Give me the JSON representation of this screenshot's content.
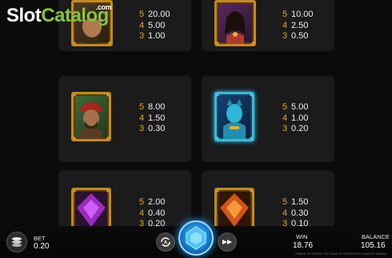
{
  "logo": {
    "part1": "Slot",
    "part2": "Catalog",
    "suffix": ".com"
  },
  "symbols": [
    {
      "name": "prince-symbol",
      "pays": [
        {
          "count": "5",
          "value": "20.00"
        },
        {
          "count": "4",
          "value": "5.00"
        },
        {
          "count": "3",
          "value": "1.00"
        }
      ]
    },
    {
      "name": "princess-symbol",
      "pays": [
        {
          "count": "5",
          "value": "10.00"
        },
        {
          "count": "4",
          "value": "2.50"
        },
        {
          "count": "3",
          "value": "0.50"
        }
      ]
    },
    {
      "name": "turbaned-man-symbol",
      "pays": [
        {
          "count": "5",
          "value": "8.00"
        },
        {
          "count": "4",
          "value": "1.50"
        },
        {
          "count": "3",
          "value": "0.30"
        }
      ]
    },
    {
      "name": "genie-symbol",
      "pays": [
        {
          "count": "5",
          "value": "5.00"
        },
        {
          "count": "4",
          "value": "1.00"
        },
        {
          "count": "3",
          "value": "0.20"
        }
      ]
    },
    {
      "name": "purple-gem-symbol",
      "pays": [
        {
          "count": "5",
          "value": "2.00"
        },
        {
          "count": "4",
          "value": "0.40"
        },
        {
          "count": "3",
          "value": "0.20"
        }
      ]
    },
    {
      "name": "orange-gem-symbol",
      "pays": [
        {
          "count": "5",
          "value": "1.50"
        },
        {
          "count": "4",
          "value": "0.30"
        },
        {
          "count": "3",
          "value": "0.10"
        }
      ]
    }
  ],
  "bottom_bar": {
    "bet_label": "BET",
    "bet_value": "0.20",
    "win_label": "WIN",
    "win_value": "18.76",
    "balance_label": "BALANCE",
    "balance_value": "105.16",
    "footnote": "PRINCE OF PERSIA: THE GEMS OF PERSEPOLIS | MASCOT GAMING"
  },
  "colors": {
    "count": "#f2a614",
    "frame": "#c48a1e",
    "logo_green": "#86c43f",
    "spin_blue": "#1e8fe0"
  },
  "icons": {
    "stack": "coin-stack-icon",
    "autoplay": "autoplay-icon",
    "spin": "spin-gem-icon",
    "turbo": "turbo-icon"
  }
}
